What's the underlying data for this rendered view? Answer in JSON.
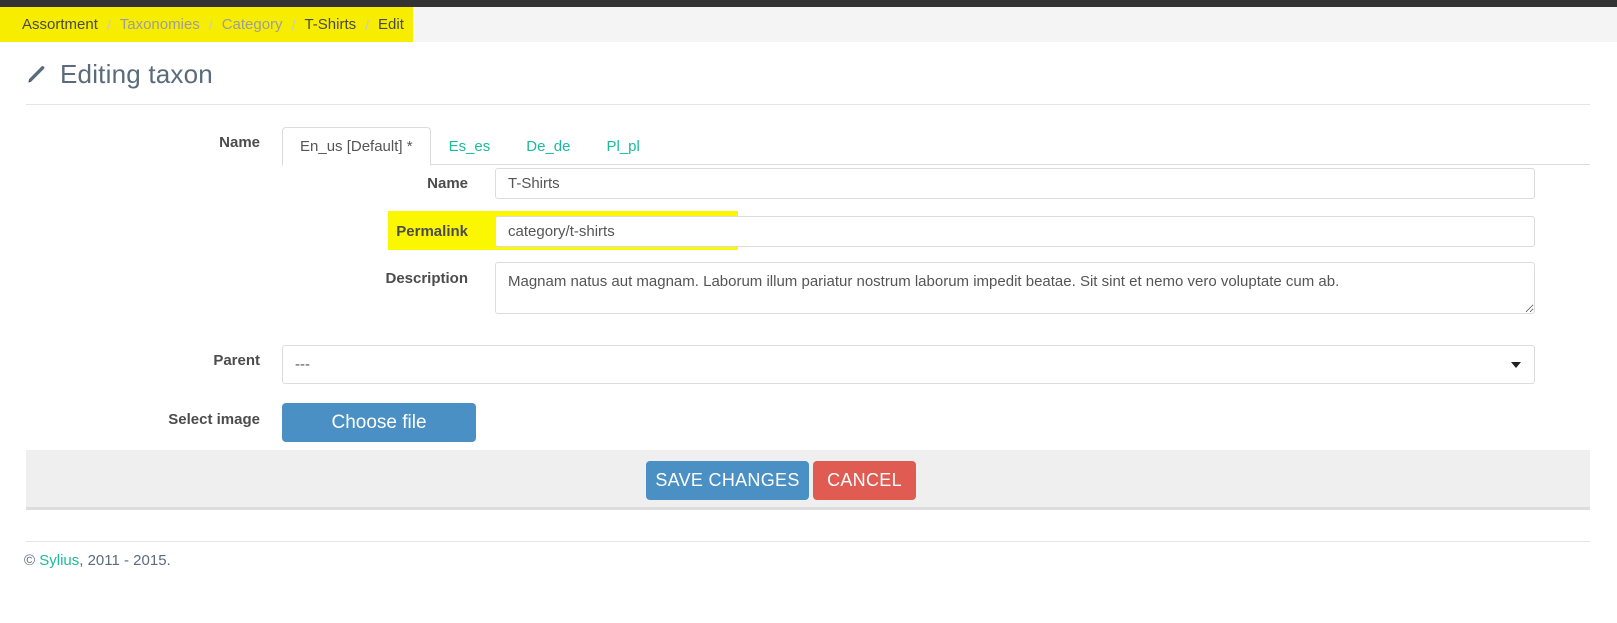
{
  "breadcrumb": {
    "items": [
      {
        "label": "Assortment",
        "muted": false
      },
      {
        "label": "Taxonomies",
        "muted": true
      },
      {
        "label": "Category",
        "muted": true
      },
      {
        "label": "T-Shirts",
        "muted": false
      },
      {
        "label": "Edit",
        "muted": false
      }
    ],
    "separator": "/",
    "highlight_color": "#f7ed00"
  },
  "page": {
    "title": "Editing taxon",
    "icon": "pencil-icon"
  },
  "form": {
    "name_section_label": "Name",
    "tabs": [
      {
        "label": "En_us [Default] *",
        "active": true
      },
      {
        "label": "Es_es",
        "active": false
      },
      {
        "label": "De_de",
        "active": false
      },
      {
        "label": "Pl_pl",
        "active": false
      }
    ],
    "fields": {
      "name": {
        "label": "Name",
        "value": "T-Shirts",
        "placeholder": ""
      },
      "permalink": {
        "label": "Permalink",
        "value": "category/t-shirts",
        "placeholder": "",
        "highlight_color": "#faf700"
      },
      "description": {
        "label": "Description",
        "value": "Magnam natus aut magnam. Laborum illum pariatur nostrum laborum impedit beatae. Sit sint et nemo vero voluptate cum ab.",
        "placeholder": ""
      },
      "parent": {
        "label": "Parent",
        "value": "---",
        "options": [
          "---"
        ]
      },
      "select_image": {
        "label": "Select image",
        "button_label": "Choose file"
      }
    }
  },
  "actions": {
    "save_label": "SAVE CHANGES",
    "cancel_label": "CANCEL",
    "save_color": "#4a90c4",
    "cancel_color": "#e05b52"
  },
  "footer": {
    "copyright_symbol": "©",
    "brand": "Sylius",
    "years": ", 2011 - 2015."
  }
}
